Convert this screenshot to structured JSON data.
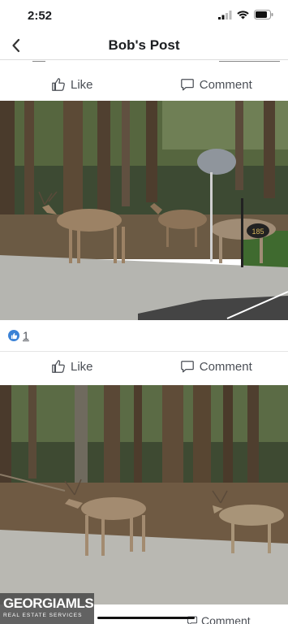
{
  "status": {
    "time": "2:52"
  },
  "nav": {
    "title": "Bob's Post"
  },
  "actions": {
    "like_label": "Like",
    "comment_label": "Comment"
  },
  "reactions": {
    "count": "1"
  },
  "mailbox": {
    "number": "185"
  },
  "watermark": {
    "brand": "GEORGIAMLS",
    "tagline": "REAL ESTATE SERVICES"
  },
  "partial": {
    "comment_label": "Comment"
  },
  "colors": {
    "like_badge": "#3b82d6",
    "text_muted": "#4b4f56"
  }
}
